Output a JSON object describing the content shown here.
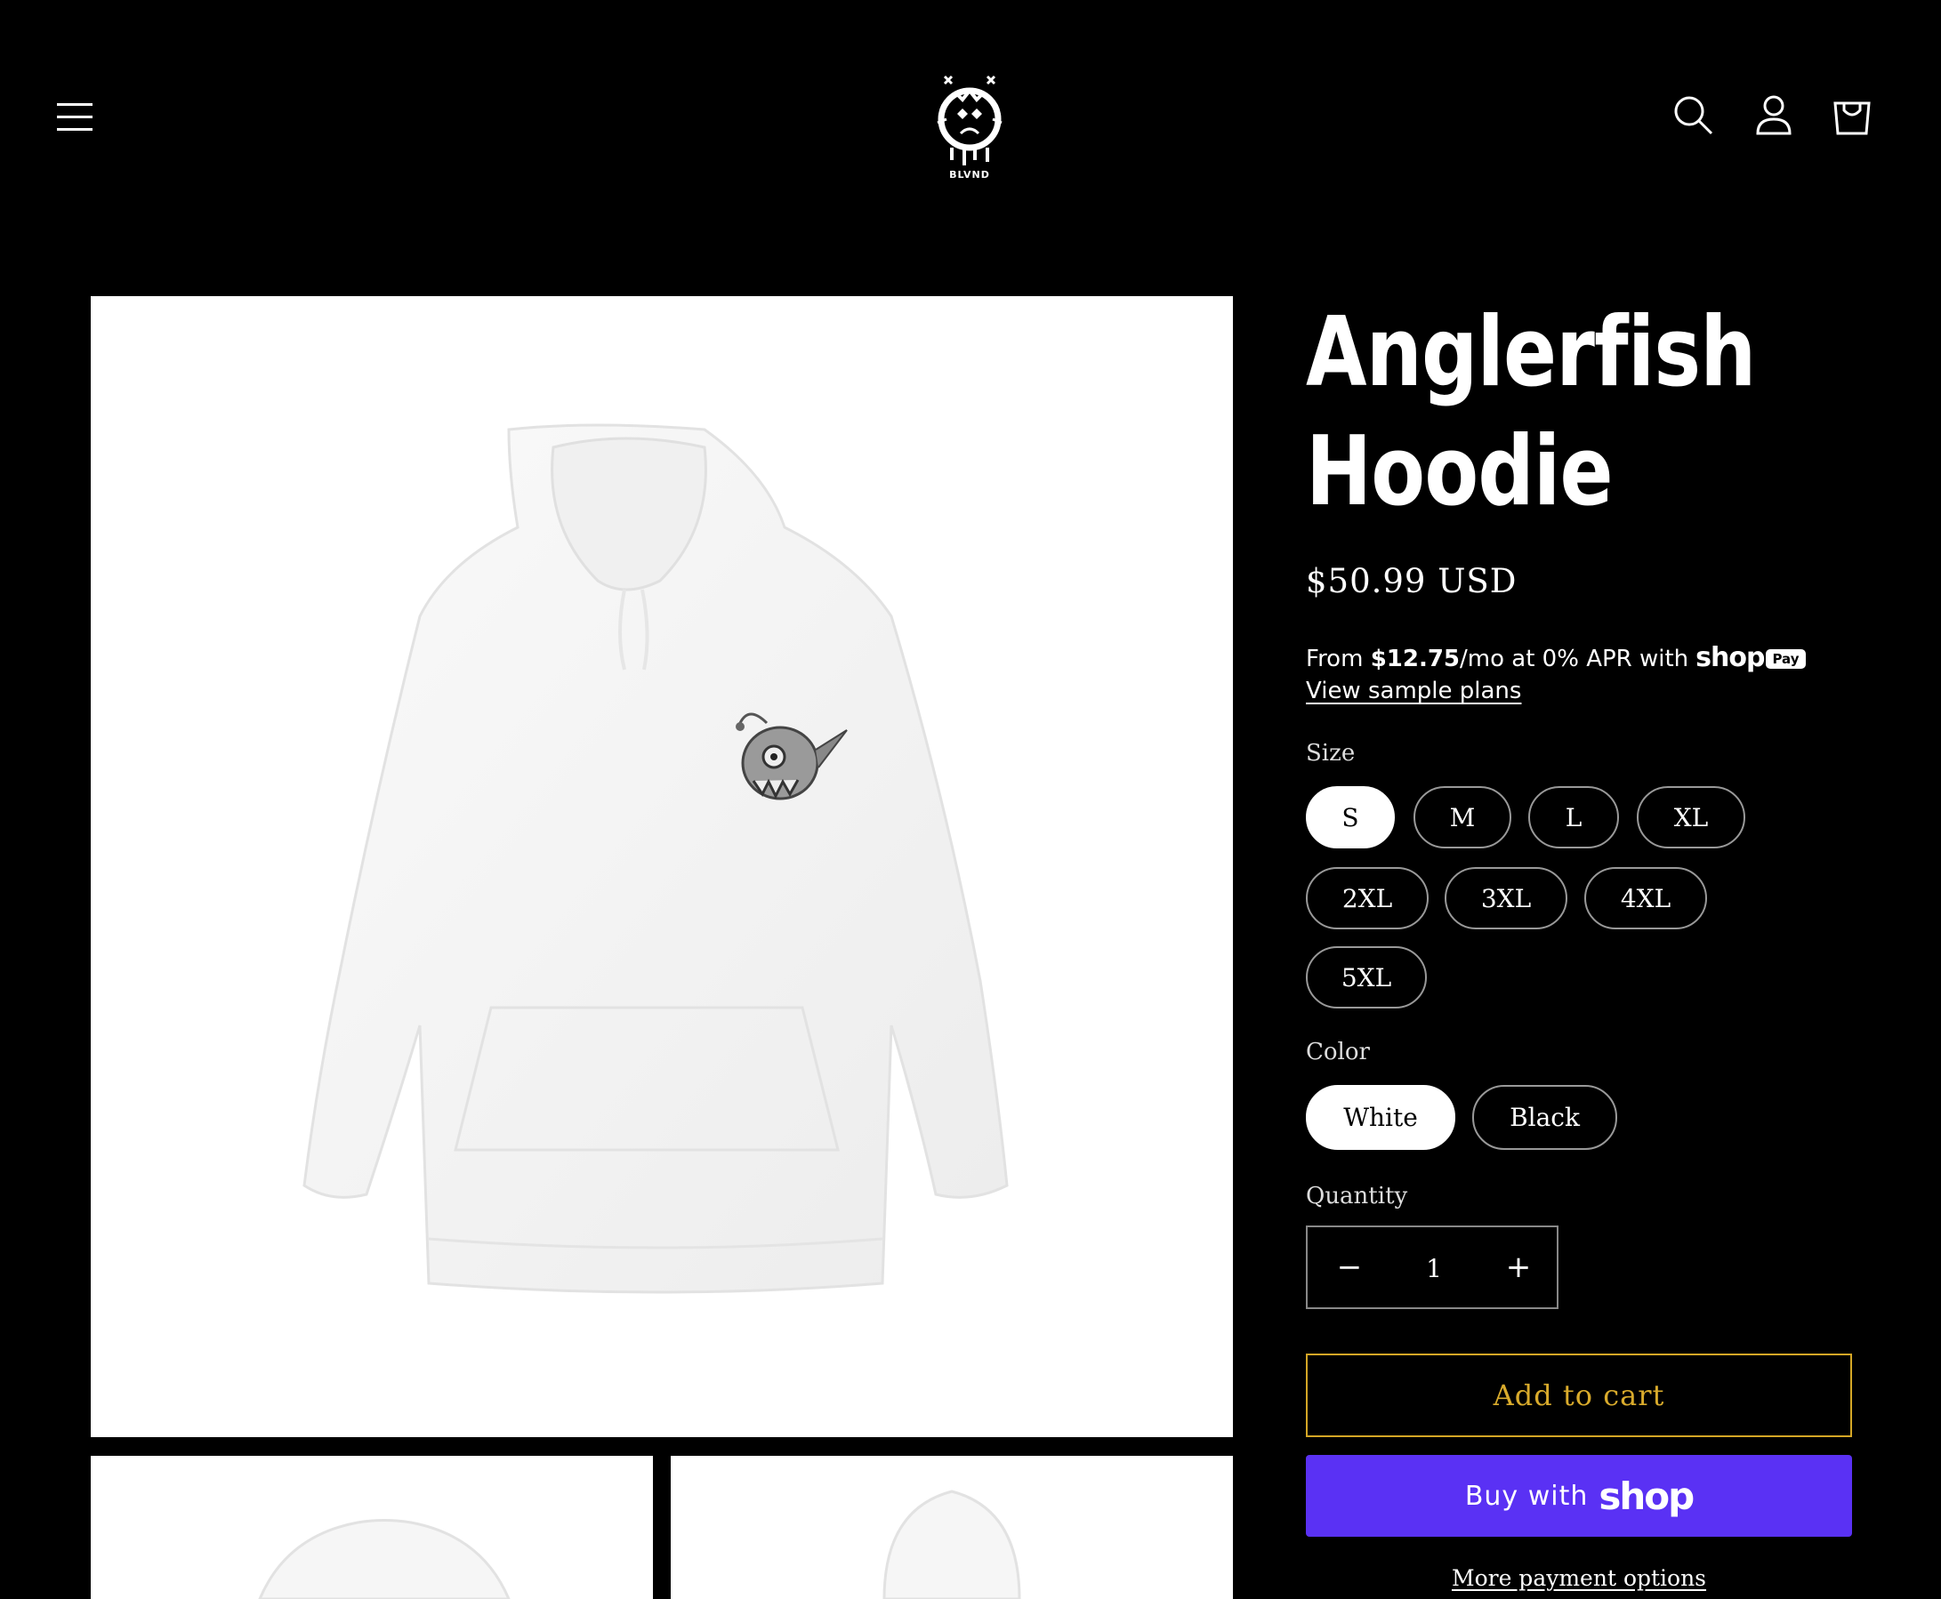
{
  "header": {
    "logo_text": "BLVND",
    "icons": [
      "menu-icon",
      "search-icon",
      "account-icon",
      "cart-icon"
    ]
  },
  "product": {
    "title": "Anglerfish Hoodie",
    "price": "$50.99 USD",
    "installments": {
      "prefix": "From ",
      "amount": "$12.75",
      "suffix": "/mo at 0% APR with",
      "brand": "shop",
      "badge": "Pay",
      "link": "View sample plans"
    },
    "size": {
      "label": "Size",
      "selected": "S",
      "options": [
        "S",
        "M",
        "L",
        "XL",
        "2XL",
        "3XL",
        "4XL",
        "5XL"
      ]
    },
    "color": {
      "label": "Color",
      "selected": "White",
      "options": [
        "White",
        "Black"
      ]
    },
    "quantity": {
      "label": "Quantity",
      "value": "1",
      "minus": "−",
      "plus": "+"
    },
    "add_to_cart": "Add to cart",
    "buy_with": "Buy with",
    "buy_brand": "shop",
    "more_payment": "More payment options"
  },
  "colors": {
    "background": "#000000",
    "add_to_cart_accent": "#d9ab2c",
    "shop_pay_purple": "#5a31f4"
  }
}
